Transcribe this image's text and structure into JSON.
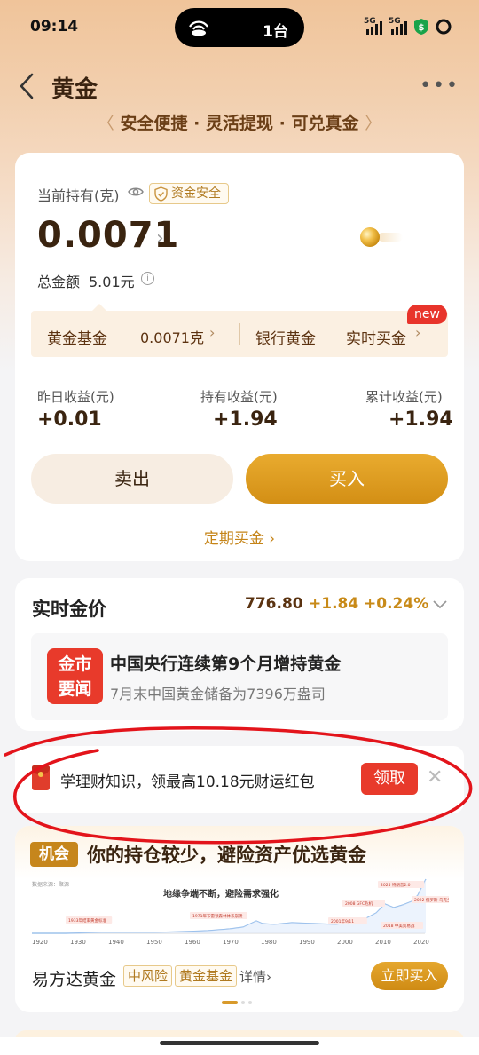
{
  "status": {
    "time": "09:14",
    "cast_count": "1台",
    "net1": "5G",
    "net2": "5G"
  },
  "nav": {
    "title": "黄金",
    "tagline": "安全便捷 · 灵活提现 · 可兑真金"
  },
  "holdings": {
    "label": "当前持有(克)",
    "safe_badge": "资金安全",
    "grams": "0.0071",
    "total_label": "总金额",
    "total_value": "5.01元",
    "strip": {
      "fund": "黄金基金",
      "fund_grams": "0.0071克",
      "bank": "银行黄金",
      "realtime": "实时买金",
      "new_badge": "new"
    },
    "income": [
      {
        "label": "昨日收益(元)",
        "value": "+0.01"
      },
      {
        "label": "持有收益(元)",
        "value": "+1.94"
      },
      {
        "label": "累计收益(元)",
        "value": "+1.94"
      }
    ],
    "sell": "卖出",
    "buy": "买入",
    "fixed_buy": "定期买金 ›"
  },
  "realtime": {
    "title": "实时金价",
    "price": "776.80",
    "change": "+1.84",
    "pct": "+0.24%",
    "news_logo_1": "金市",
    "news_logo_2": "要闻",
    "news_title": "中国央行连续第9个月增持黄金",
    "news_sub": "7月末中国黄金储备为7396万盎司"
  },
  "promo": {
    "text": "学理财知识，领最高10.18元财运红包",
    "claim": "领取"
  },
  "opportunity": {
    "badge": "机会",
    "title": "你的持仓较少，避险资产优选黄金",
    "chart_source": "数据来源：聚源",
    "chart_headline": "地缘争端不断，避险需求强化",
    "chart_years": [
      "1920",
      "1930",
      "1940",
      "1950",
      "1960",
      "1970",
      "1980",
      "1990",
      "2000",
      "2010",
      "2020"
    ],
    "chart_notes": [
      "1933年结束黄金标准",
      "1971年布雷顿森林体系崩溃",
      "2001年9/11",
      "2008 GFC危机",
      "2018 中美贸易战",
      "2022 俄罗斯-乌克兰",
      "2025 特朗普2.0"
    ],
    "fund_name": "易方达黄金",
    "tag_risk": "中风险",
    "tag_type": "黄金基金",
    "detail": "详情›",
    "buy_now": "立即买入"
  },
  "colors": {
    "accent": "#d38f15",
    "red": "#e83a2b",
    "brown": "#3a2410"
  }
}
